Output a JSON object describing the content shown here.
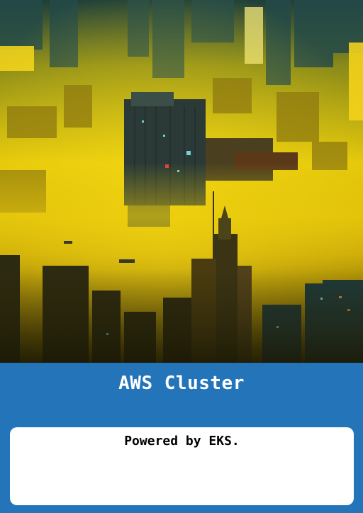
{
  "card": {
    "title": "AWS Cluster",
    "description": "Powered by EKS.",
    "accent_color": "#2474b9",
    "panel_color": "#ffffff"
  },
  "artwork": {
    "subject": "futuristic city skyline in yellow haze",
    "palette": [
      "#f2d400",
      "#c9a400",
      "#1c2a2c",
      "#0f3b3e"
    ]
  }
}
